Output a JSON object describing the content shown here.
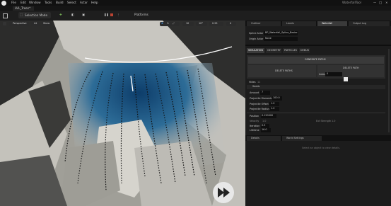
{
  "menu": {
    "items": [
      "File",
      "Edit",
      "Window",
      "Tools",
      "Build",
      "Select",
      "Actor",
      "Help"
    ]
  },
  "window": {
    "project": "LVL_Trees*",
    "title": "WaterfallTool",
    "controls": [
      "—",
      "□",
      "×"
    ]
  },
  "toolbar": {
    "save": "Save",
    "mode": "Selection Mode",
    "platforms": "Platforms"
  },
  "viewport": {
    "view": "Perspective",
    "lit": "Lit",
    "show": "Show",
    "grid": "10",
    "angle": "10°",
    "scale": "0.25",
    "cam": "4"
  },
  "outliner_tabs": [
    "Outliner",
    "Levels",
    "Waterfall",
    "Output Log"
  ],
  "active_tab": "Waterfall",
  "spline_actor": {
    "label": "Spline Actor",
    "value": "BP_Waterfall_Spline_Bezier"
  },
  "origin_actor": {
    "label": "Origin Actor",
    "value": "None"
  },
  "sub_tabs": [
    "SIMULATION",
    "GEOMETRY",
    "PARTICLES",
    "DEBUG"
  ],
  "active_sub_tab": "SIMULATION",
  "generate_button": "GENERATE PATHS",
  "delete_paths": "DELETE PATHS",
  "delete_path": "DELETE PATH",
  "index_label": "Index",
  "index_value": "0",
  "hide_label": "Hides",
  "hide_value": "11",
  "seed_label": "Seeds",
  "fields": [
    {
      "label": "Amount",
      "value": "7"
    },
    {
      "label": "Projectile Momentum",
      "value": "100.0"
    },
    {
      "label": "Projectile Offset",
      "value": "1.0"
    },
    {
      "label": "Projectile Radius",
      "value": "1.0"
    }
  ],
  "fields2": [
    {
      "label": "Position",
      "value": "0.150000"
    },
    {
      "label": "Velocity",
      "value": "1.0"
    },
    {
      "label": "Iteration",
      "value": "0.5"
    },
    {
      "label": "Lifetime",
      "value": "16.0"
    }
  ],
  "side_labels": {
    "ext": "Ext Strength",
    "extval": "1.0"
  },
  "bottom_tabs": [
    "Details",
    "World Settings"
  ],
  "details_hint": "Select an object to view details."
}
